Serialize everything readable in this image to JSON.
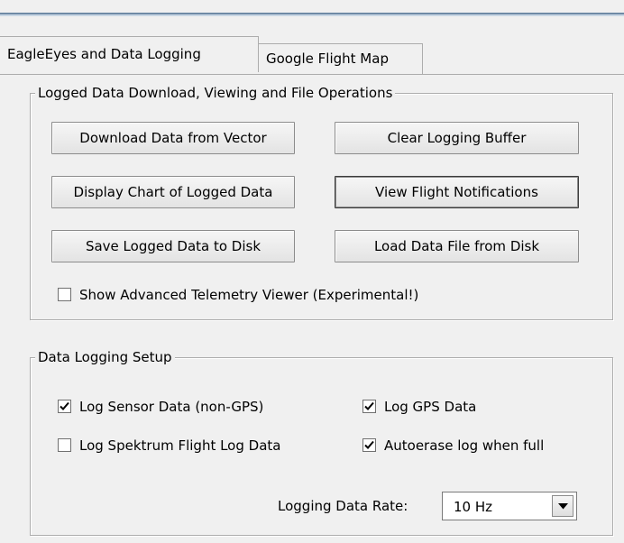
{
  "tabs": [
    {
      "label": "EagleEyes and Data Logging",
      "active": true
    },
    {
      "label": "Google Flight Map",
      "active": false
    }
  ],
  "group_file_ops": {
    "title": "Logged Data Download, Viewing and File Operations",
    "buttons": {
      "download": "Download Data from Vector",
      "clear": "Clear Logging Buffer",
      "display_chart": "Display Chart of Logged Data",
      "view_notifications": "View Flight Notifications",
      "save": "Save Logged Data to Disk",
      "load": "Load Data File from Disk"
    },
    "advanced_viewer": {
      "label": "Show Advanced Telemetry Viewer (Experimental!)",
      "checked": false
    }
  },
  "group_setup": {
    "title": "Data Logging Setup",
    "log_sensor": {
      "label": "Log Sensor Data (non-GPS)",
      "checked": true
    },
    "log_gps": {
      "label": "Log GPS Data",
      "checked": true
    },
    "log_spektrum": {
      "label": "Log Spektrum Flight Log Data",
      "checked": false
    },
    "autoerase": {
      "label": "Autoerase log when full",
      "checked": true
    },
    "rate_label": "Logging Data Rate:",
    "rate_value": "10 Hz"
  }
}
